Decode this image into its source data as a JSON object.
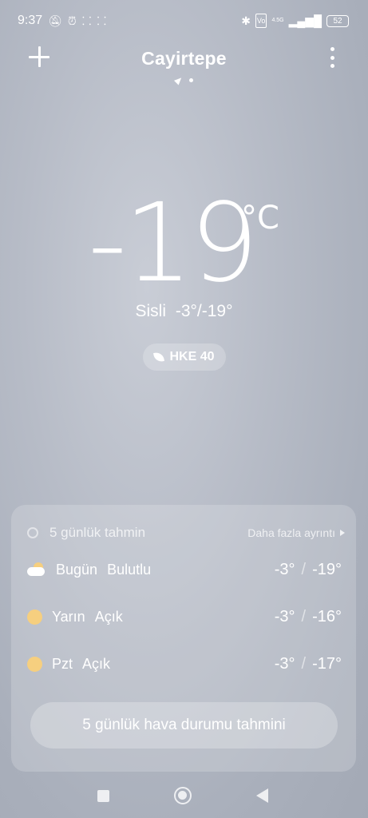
{
  "status_bar": {
    "time": "9:37",
    "left_icons": [
      "muted-bell-icon",
      "alarm-icon",
      "step-icon",
      "step-icon"
    ],
    "right_icons": [
      "bluetooth-icon",
      "volte-icon",
      "signal-icon"
    ],
    "network_label": "4.5G",
    "battery": "52"
  },
  "header": {
    "city": "Cayirtepe"
  },
  "current": {
    "temperature": "-19",
    "unit": "°C",
    "condition": "Sisli",
    "high_low": "-3°/-19°",
    "aqi_label": "HKE 40"
  },
  "forecast_card": {
    "title": "5 günlük tahmin",
    "more_label": "Daha fazla ayrıntı",
    "rows": [
      {
        "day": "Bugün",
        "condition": "Bulutlu",
        "icon": "cloud-sun-icon",
        "high": "-3°",
        "low": "-19°"
      },
      {
        "day": "Yarın",
        "condition": "Açık",
        "icon": "sun-icon",
        "high": "-3°",
        "low": "-16°"
      },
      {
        "day": "Pzt",
        "condition": "Açık",
        "icon": "sun-icon",
        "high": "-3°",
        "low": "-17°"
      }
    ],
    "button_label": "5 günlük hava durumu tahmini"
  },
  "colors": {
    "sun": "#f6cf7f",
    "background": "#b7bcc7"
  }
}
